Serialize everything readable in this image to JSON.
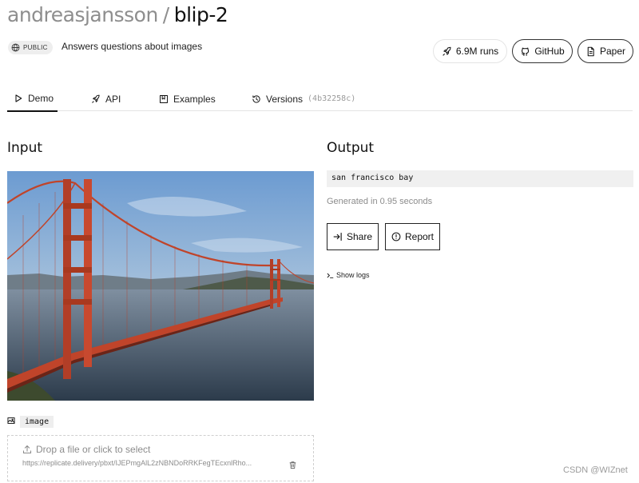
{
  "header": {
    "owner": "andreasjansson",
    "separator": "/",
    "model": "blip-2",
    "visibility": "PUBLIC",
    "description": "Answers questions about images"
  },
  "actions": {
    "runs": "6.9M runs",
    "github": "GitHub",
    "paper": "Paper"
  },
  "tabs": [
    {
      "label": "Demo",
      "icon": "play-icon",
      "active": true
    },
    {
      "label": "API",
      "icon": "rocket-icon",
      "active": false
    },
    {
      "label": "Examples",
      "icon": "bookmark-icon",
      "active": false
    },
    {
      "label": "Versions",
      "icon": "history-icon",
      "active": false,
      "version_id": "(4b32258c)"
    }
  ],
  "input": {
    "heading": "Input",
    "field_label": "image",
    "drop_text": "Drop a file or click to select",
    "url": "https://replicate.delivery/pbxt/IJEPmgAlL2zNBNDoRRKFegTEcxnlRho..."
  },
  "output": {
    "heading": "Output",
    "result": "san francisco bay",
    "generated": "Generated in 0.95 seconds",
    "share": "Share",
    "report": "Report",
    "show_logs": "Show logs"
  },
  "watermark": "CSDN @WIZnet"
}
